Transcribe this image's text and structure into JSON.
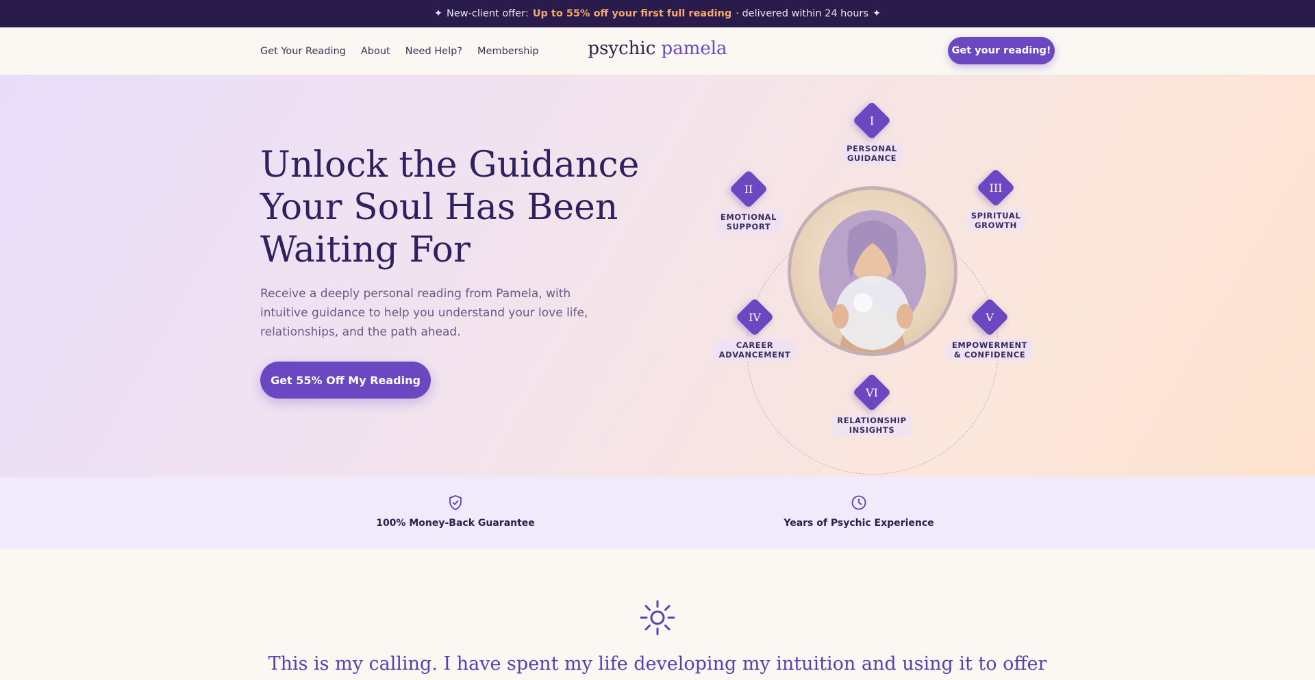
{
  "promo": {
    "star": "✦",
    "prefix": "New-client offer:",
    "highlight": "Up to 55% off your first full reading",
    "suffix": "· delivered within 24 hours"
  },
  "nav": {
    "links": [
      "Get Your Reading",
      "About",
      "Need Help?",
      "Membership"
    ],
    "logo_part1": "psychic",
    "logo_part2": "pamela",
    "cta": "Get your reading!"
  },
  "hero": {
    "title": "Unlock the Guidance Your Soul Has Been Waiting For",
    "lead": "Receive a deeply personal reading from Pamela, with intuitive guidance to help you understand your love life, relationships, and the path ahead.",
    "cta": "Get 55% Off My Reading"
  },
  "orbit_nodes": [
    {
      "numeral": "I",
      "label_line1": "PERSONAL",
      "label_line2": "GUIDANCE"
    },
    {
      "numeral": "II",
      "label_line1": "EMOTIONAL",
      "label_line2": "SUPPORT"
    },
    {
      "numeral": "III",
      "label_line1": "SPIRITUAL",
      "label_line2": "GROWTH"
    },
    {
      "numeral": "IV",
      "label_line1": "CAREER",
      "label_line2": "ADVANCEMENT"
    },
    {
      "numeral": "V",
      "label_line1": "EMPOWERMENT",
      "label_line2": "& CONFIDENCE"
    },
    {
      "numeral": "VI",
      "label_line1": "RELATIONSHIP",
      "label_line2": "INSIGHTS"
    }
  ],
  "trust": {
    "items": [
      {
        "icon": "shield-check-icon",
        "text": "100% Money-Back Guarantee"
      },
      {
        "icon": "clock-icon",
        "text": "Years of Psychic Experience"
      }
    ]
  },
  "about": {
    "icon": "sun-icon",
    "quote": "This is my calling. I have spent my life developing my intuition and using it to offer"
  },
  "colors": {
    "accent": "#6b48c2",
    "dark": "#291c4d",
    "highlight": "#f4a86b"
  }
}
